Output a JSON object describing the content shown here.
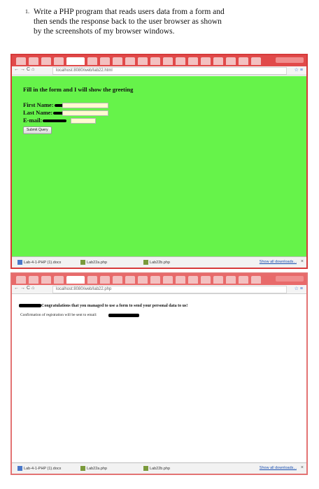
{
  "question": {
    "number": "1.",
    "line1": "Write a PHP program that reads users data from a form and",
    "line2": "then sends the response back to the user browser as shown",
    "line3": "by the screenshots of my browser windows."
  },
  "window1": {
    "url": "localhost:8080/web/lab22.html",
    "greeting": "Fill in the form and I will show the greeting",
    "first_name_label": "First Name:",
    "last_name_label": "Last Name:",
    "email_label": "E-mail:",
    "submit_label": "Submit Query",
    "page_color": "#66f34a",
    "downloads": [
      "Lab-4-1-PHP (1).docx",
      "Lab22a.php",
      "Lab22b.php"
    ],
    "show_all": "Show all downloads...",
    "close": "×"
  },
  "window2": {
    "url": "localhost:8080/web/lab22.php",
    "congrats": "Congratulations that you managed to use a form to send your personal data to us!",
    "confirm": "Confirmation of registration will be sent to email:",
    "downloads": [
      "Lab-4-1-PHP (1).docx",
      "Lab22a.php",
      "Lab22b.php"
    ],
    "show_all": "Show all downloads...",
    "close": "×"
  },
  "colors": {
    "browser_frame": "#d63a3a",
    "tab_strip": "#e14a4a"
  },
  "icons": [
    "back-arrow-icon",
    "forward-arrow-icon",
    "reload-icon",
    "home-icon",
    "star-icon",
    "menu-icon",
    "file-icon"
  ]
}
